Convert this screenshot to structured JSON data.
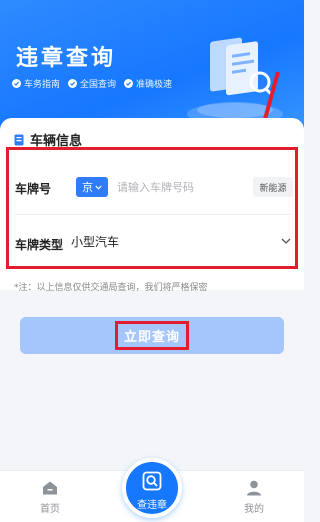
{
  "header": {
    "title": "违章查询",
    "features": [
      "车务指南",
      "全国查询",
      "准确极速"
    ]
  },
  "vehicle_card": {
    "title": "车辆信息",
    "plate_label": "车牌号",
    "province": "京",
    "plate_placeholder": "请输入车牌号码",
    "plate_value": "",
    "new_energy_label": "新能源",
    "type_label": "车牌类型",
    "type_value": "小型汽车"
  },
  "note": "*注：以上信息仅供交通局查询，我们将严格保密",
  "query_button_label": "立即查询",
  "tabbar": {
    "home": "首页",
    "center": "查违章",
    "mine": "我的"
  },
  "colors": {
    "primary": "#1677ff",
    "button_disabled": "#a4c6fb",
    "annotation_red": "#e11d2e"
  },
  "icons": [
    "check-icon",
    "document-icon",
    "chevron-down-icon",
    "home-icon",
    "search-document-icon",
    "user-icon",
    "annotation-arrow"
  ]
}
